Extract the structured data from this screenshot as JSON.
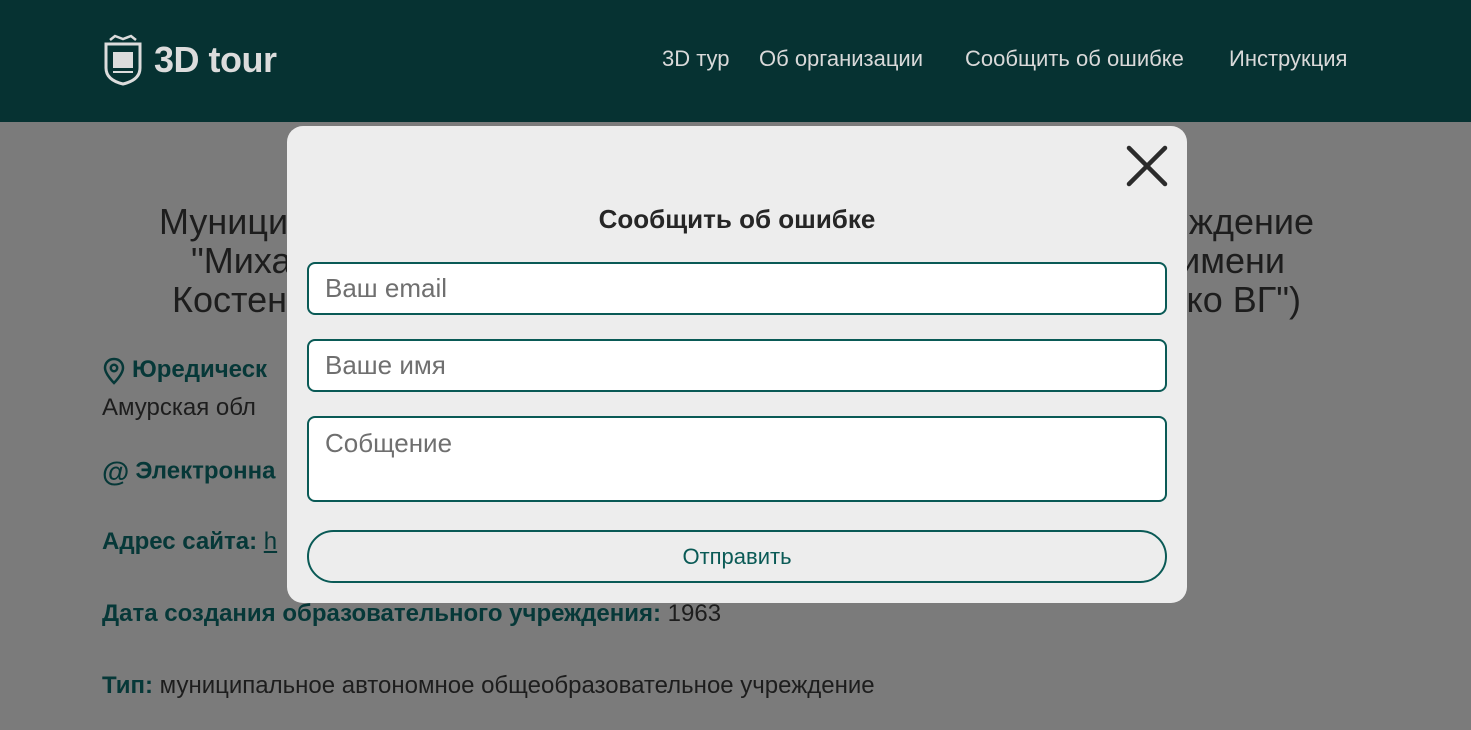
{
  "header": {
    "logo_text": "3D tour",
    "nav": [
      {
        "label": "3D тур"
      },
      {
        "label": "Об организации"
      },
      {
        "label": "Сообщить об ошибке"
      },
      {
        "label": "Инструкция"
      }
    ]
  },
  "background_page": {
    "title_lines": [
      "Муници                                              ждение",
      "\"Миха                                              имени",
      "Костен                                              ко ВГ\")"
    ],
    "legal_address_label": "Юредическ",
    "legal_address_value": "Амурская обл",
    "email_label": "Электронна",
    "site_label": "Адрес сайта:",
    "site_value": "h",
    "date_label": "Дата создания образовательного учреждения:",
    "date_value": "1963",
    "type_label": "Тип:",
    "type_value": "муниципальное автономное общеобразовательное учреждение"
  },
  "modal": {
    "title": "Сообщить об ошибке",
    "email_placeholder": "Ваш email",
    "name_placeholder": "Ваше имя",
    "message_placeholder": "Собщение",
    "submit_label": "Отправить"
  },
  "colors": {
    "header_bg": "#063232",
    "overlay_bg": "#7b7b7b",
    "modal_bg": "#ededed",
    "accent": "#0a5a56"
  }
}
